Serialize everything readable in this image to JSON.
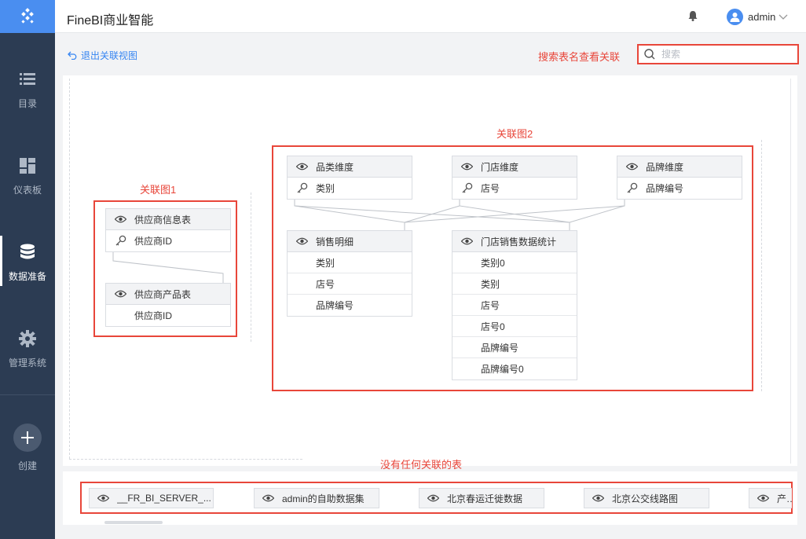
{
  "header": {
    "title": "FineBI商业智能",
    "user": "admin"
  },
  "sidebar": {
    "items": [
      {
        "label": "目录",
        "icon": "list-icon"
      },
      {
        "label": "仪表板",
        "icon": "dashboard-icon"
      },
      {
        "label": "数据准备",
        "icon": "database-icon"
      },
      {
        "label": "管理系统",
        "icon": "gear-icon"
      }
    ],
    "create_label": "创建",
    "active": "数据准备"
  },
  "toolbar": {
    "back_label": "退出关联视图",
    "search_annotation": "搜索表名查看关联",
    "search_placeholder": "搜索"
  },
  "annotations": {
    "group1": "关联图1",
    "group2": "关联图2",
    "unrelated": "没有任何关联的表"
  },
  "tables": {
    "supplier_info": {
      "name": "供应商信息表",
      "fields": [
        "供应商ID"
      ]
    },
    "supplier_product": {
      "name": "供应商产品表",
      "fields": [
        "供应商ID"
      ]
    },
    "category_dim": {
      "name": "品类维度",
      "fields": [
        "类别"
      ]
    },
    "store_dim": {
      "name": "门店维度",
      "fields": [
        "店号"
      ]
    },
    "brand_dim": {
      "name": "品牌维度",
      "fields": [
        "品牌编号"
      ]
    },
    "sales_detail": {
      "name": "销售明细",
      "fields": [
        "类别",
        "店号",
        "品牌编号"
      ]
    },
    "store_sales_stats": {
      "name": "门店销售数据统计",
      "fields": [
        "类别0",
        "类别",
        "店号",
        "店号0",
        "品牌编号",
        "品牌编号0"
      ]
    }
  },
  "unrelated_tables": [
    "__FR_BI_SERVER_...",
    "admin的自助数据集",
    "北京春运迁徙数据",
    "北京公交线路图",
    "产品"
  ],
  "colors": {
    "accent": "#3685f2",
    "sidebar": "#2c3c53",
    "annotation_red": "#e8463a"
  }
}
